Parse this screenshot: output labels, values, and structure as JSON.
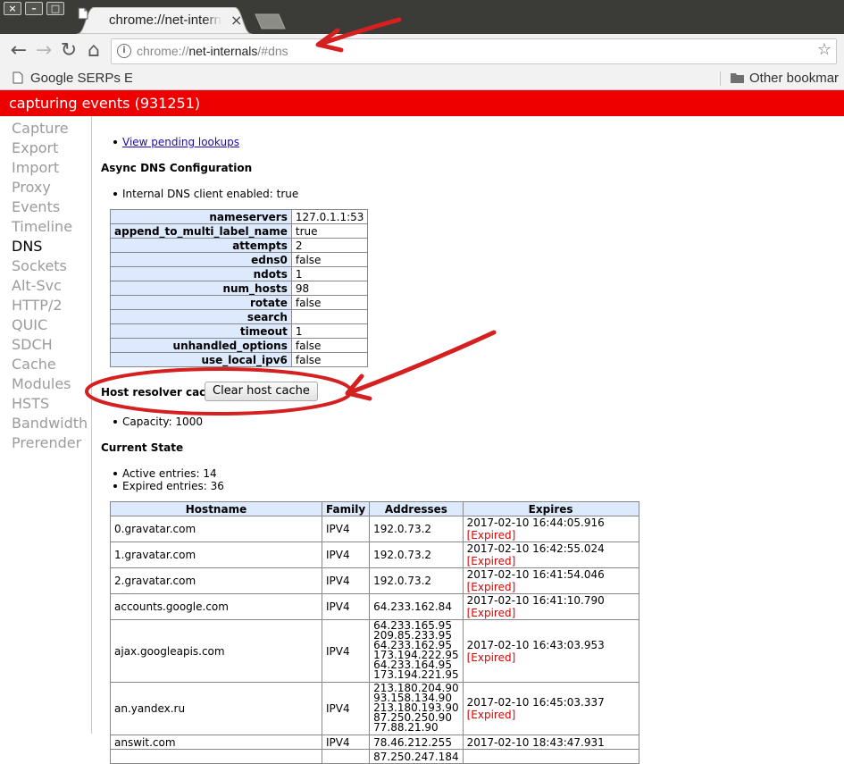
{
  "window": {
    "controls": [
      "×",
      "–",
      "□"
    ],
    "tab_title": "chrome://net-internals/#dns",
    "tab_close": "×"
  },
  "toolbar": {
    "back": "←",
    "forward": "→",
    "reload": "↻",
    "home": "⌂",
    "url_scheme": "chrome://",
    "url_host": "net-internals",
    "url_path": "/#dns",
    "star": "☆"
  },
  "bookmarks": {
    "item": "Google SERPs Ex",
    "other": "Other bookmar"
  },
  "status": {
    "text": "capturing events (931251)",
    "color": "#ee0000"
  },
  "sidebar": {
    "items": [
      "Capture",
      "Export",
      "Import",
      "Proxy",
      "Events",
      "Timeline",
      "DNS",
      "Sockets",
      "Alt-Svc",
      "HTTP/2",
      "QUIC",
      "SDCH",
      "Cache",
      "Modules",
      "HSTS",
      "Bandwidth",
      "Prerender"
    ],
    "active": "DNS"
  },
  "dns": {
    "pending_link": "View pending lookups",
    "async_heading": "Async DNS Configuration",
    "internal_enabled": "Internal DNS client enabled: true",
    "config": [
      {
        "key": "nameservers",
        "value": "127.0.1.1:53"
      },
      {
        "key": "append_to_multi_label_name",
        "value": "true"
      },
      {
        "key": "attempts",
        "value": "2"
      },
      {
        "key": "edns0",
        "value": "false"
      },
      {
        "key": "ndots",
        "value": "1"
      },
      {
        "key": "num_hosts",
        "value": "98"
      },
      {
        "key": "rotate",
        "value": "false"
      },
      {
        "key": "search",
        "value": ""
      },
      {
        "key": "timeout",
        "value": "1"
      },
      {
        "key": "unhandled_options",
        "value": "false"
      },
      {
        "key": "use_local_ipv6",
        "value": "false"
      }
    ],
    "host_cache_label": "Host resolver cache",
    "clear_button": "Clear host cache",
    "capacity": "Capacity: 1000",
    "current_state_heading": "Current State",
    "active_entries": "Active entries: 14",
    "expired_entries": "Expired entries: 36",
    "table_headers": [
      "Hostname",
      "Family",
      "Addresses",
      "Expires"
    ],
    "expired_label": "[Expired]",
    "rows": [
      {
        "hostname": "0.gravatar.com",
        "family": "IPV4",
        "addresses": [
          "192.0.73.2"
        ],
        "expires": "2017-02-10 16:44:05.916",
        "expired": true
      },
      {
        "hostname": "1.gravatar.com",
        "family": "IPV4",
        "addresses": [
          "192.0.73.2"
        ],
        "expires": "2017-02-10 16:42:55.024",
        "expired": true
      },
      {
        "hostname": "2.gravatar.com",
        "family": "IPV4",
        "addresses": [
          "192.0.73.2"
        ],
        "expires": "2017-02-10 16:41:54.046",
        "expired": true
      },
      {
        "hostname": "accounts.google.com",
        "family": "IPV4",
        "addresses": [
          "64.233.162.84"
        ],
        "expires": "2017-02-10 16:41:10.790",
        "expired": true
      },
      {
        "hostname": "ajax.googleapis.com",
        "family": "IPV4",
        "addresses": [
          "64.233.165.95",
          "209.85.233.95",
          "64.233.162.95",
          "173.194.222.95",
          "64.233.164.95",
          "173.194.221.95"
        ],
        "expires": "2017-02-10 16:43:03.953",
        "expired": true
      },
      {
        "hostname": "an.yandex.ru",
        "family": "IPV4",
        "addresses": [
          "213.180.204.90",
          "93.158.134.90",
          "213.180.193.90",
          "87.250.250.90",
          "77.88.21.90"
        ],
        "expires": "2017-02-10 16:45:03.337",
        "expired": true
      },
      {
        "hostname": "answit.com",
        "family": "IPV4",
        "addresses": [
          "78.46.212.255"
        ],
        "expires": "2017-02-10 18:43:47.931",
        "expired": false
      },
      {
        "hostname": "",
        "family": "",
        "addresses": [
          "87.250.247.184"
        ],
        "expires": "",
        "expired": false
      }
    ]
  },
  "annotation_color": "#d42020"
}
